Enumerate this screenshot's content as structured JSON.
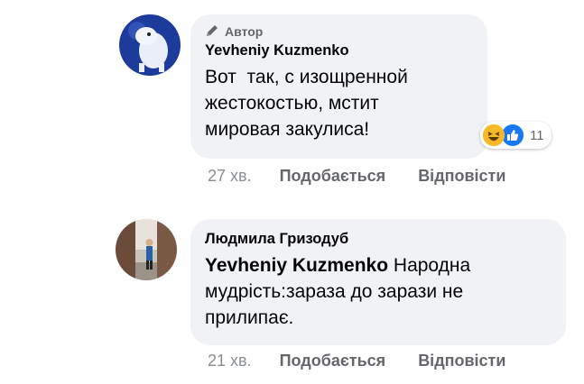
{
  "comments": [
    {
      "badge": "Автор",
      "author": "Yevheniy Kuzmenko",
      "lines": [
        "Вот  так, с изощренной",
        "жестокостью, мстит",
        "мировая закулиса!"
      ],
      "reactions": {
        "icons": [
          "haha-icon",
          "like-icon"
        ],
        "count": "11"
      },
      "time": "27 хв.",
      "like_label": "Подобається",
      "reply_label": "Відповісти"
    },
    {
      "author": "Людмила Гризодуб",
      "mention": "Yevheniy Kuzmenko",
      "line1_rest": " Народна",
      "lines": [
        "мудрість:зараза до зарази не",
        "прилипає."
      ],
      "time": "21 хв.",
      "like_label": "Подобається",
      "reply_label": "Відповісти"
    }
  ],
  "colors": {
    "bubble": "#f0f2f5",
    "secondary_text": "#65676b",
    "like_blue": "#1877f2",
    "haha_yellow": "#f7b928"
  }
}
